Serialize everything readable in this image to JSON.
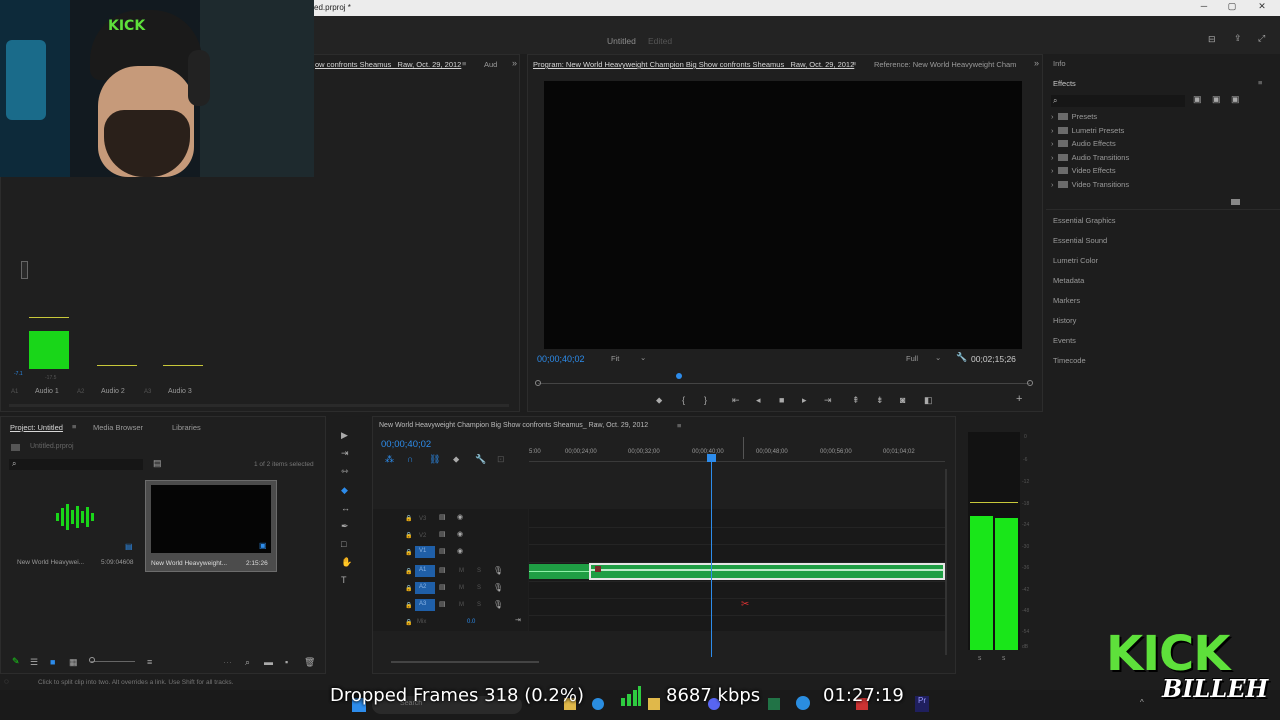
{
  "window": {
    "title": "ed.prproj *"
  },
  "header": {
    "project_title": "Untitled",
    "edited_label": "Edited"
  },
  "source_panel": {
    "tab_label": "ow confronts Sheamus_ Raw, Oct. 29, 2012",
    "tab2_label": "Aud"
  },
  "program_monitor": {
    "tab_label": "Program: New World Heavyweight Champion Big Show confronts Sheamus_ Raw, Oct. 29, 2012",
    "reference_tab": "Reference: New World Heavyweight Cham",
    "timecode": "00;00;40;02",
    "fit_label": "Fit",
    "quality_label": "Full",
    "duration": "00;02;15;26"
  },
  "audio_mixer": {
    "channels": [
      {
        "id": "A1",
        "name": "Audio 1",
        "value": "-17.5",
        "level": 0.42
      },
      {
        "id": "A2",
        "name": "Audio 2",
        "value": "",
        "level": 0.01
      },
      {
        "id": "A3",
        "name": "Audio 3",
        "value": "",
        "level": 0.01
      }
    ]
  },
  "effects_panel": {
    "info_label": "Info",
    "title": "Effects",
    "items": [
      "Presets",
      "Lumetri Presets",
      "Audio Effects",
      "Audio Transitions",
      "Video Effects",
      "Video Transitions"
    ],
    "sections": [
      "Essential Graphics",
      "Essential Sound",
      "Lumetri Color",
      "Metadata",
      "Markers",
      "History",
      "Events",
      "Timecode"
    ]
  },
  "project_panel": {
    "tabs": [
      "Project: Untitled",
      "Media Browser",
      "Libraries"
    ],
    "file_name": "Untitled.prproj",
    "item_count": "1 of 2 items selected",
    "items": [
      {
        "name": "New World Heavywei...",
        "duration": "5:09:04608"
      },
      {
        "name": "New World Heavyweight...",
        "duration": "2:15:26"
      }
    ]
  },
  "timeline": {
    "sequence_name": "New World Heavyweight Champion Big Show confronts Sheamus_ Raw, Oct. 29, 2012",
    "timecode": "00;00;40;02",
    "ruler": [
      "5:00",
      "00;00;24;00",
      "00;00;32;00",
      "00;00;40;00",
      "00;00;48;00",
      "00;00;56;00",
      "00;01;04;02"
    ],
    "video_tracks": [
      "V3",
      "V2",
      "V1"
    ],
    "audio_tracks": [
      "A1",
      "A2",
      "A3"
    ],
    "mix_label": "Mix",
    "mix_value": "0.0",
    "meter_scale": [
      "0",
      "-6",
      "-12",
      "-18",
      "-24",
      "-30",
      "-36",
      "-42",
      "-48",
      "-54",
      "dB"
    ],
    "meter_solo": [
      "S",
      "S"
    ]
  },
  "status_bar": {
    "hint": "Click to split clip into two. Alt overrides a link. Use Shift for all tracks."
  },
  "stream_overlay": {
    "dropped_frames": "Dropped Frames 318 (0.2%)",
    "bitrate": "8687 kbps",
    "clock": "01:27:19",
    "logo_line1": "KICK",
    "logo_line2": "BILLEH"
  },
  "taskbar": {
    "search_placeholder": "Search"
  },
  "colors": {
    "accent": "#2d8ceb",
    "audio_clip": "#1f9e44",
    "meter_green": "#19e619",
    "logo_green": "#5ee03b"
  }
}
